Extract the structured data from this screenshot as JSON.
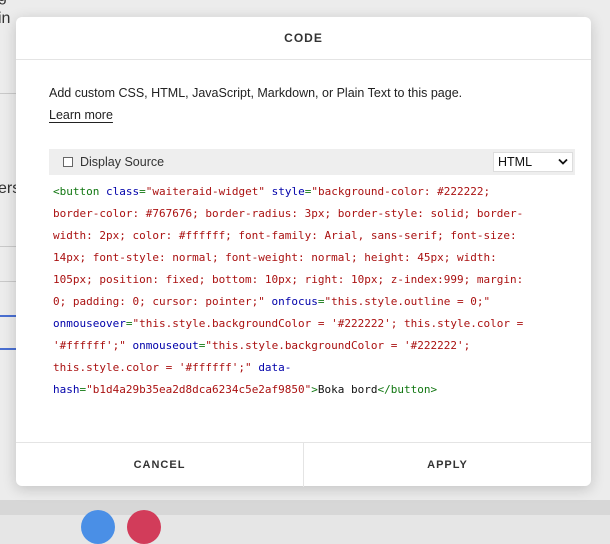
{
  "background": {
    "fragments": [
      "g",
      "in",
      "ers"
    ],
    "dark_text_color": "#333333",
    "accent_blue": "#4a6fd1"
  },
  "modal": {
    "title": "CODE",
    "description": "Add custom CSS, HTML, JavaScript, Markdown, or Plain Text to this page.",
    "learn_more": "Learn more",
    "display_source_label": "Display Source",
    "display_source_checked": false,
    "language_selected": "HTML",
    "chevron_icon": "chevron-down-icon",
    "code_lines": [
      [
        {
          "t": "tag",
          "v": "<button "
        },
        {
          "t": "attr",
          "v": "class"
        },
        {
          "t": "tag",
          "v": "="
        },
        {
          "t": "str",
          "v": "\"waiteraid-widget\""
        },
        {
          "t": "text",
          "v": " "
        },
        {
          "t": "attr",
          "v": "style"
        },
        {
          "t": "tag",
          "v": "="
        },
        {
          "t": "str",
          "v": "\"background-color: #222222;"
        }
      ],
      [
        {
          "t": "str",
          "v": "border-color: #767676; border-radius: 3px; border-style: solid; border-"
        }
      ],
      [
        {
          "t": "str",
          "v": "width: 2px; color: #ffffff; font-family: Arial, sans-serif; font-size:"
        }
      ],
      [
        {
          "t": "str",
          "v": "14px; font-style: normal; font-weight: normal; height: 45px; width:"
        }
      ],
      [
        {
          "t": "str",
          "v": "105px; position: fixed; bottom: 10px; right: 10px; z-index:999; margin:"
        }
      ],
      [
        {
          "t": "str",
          "v": "0; padding: 0; cursor: pointer;\""
        },
        {
          "t": "text",
          "v": " "
        },
        {
          "t": "attr",
          "v": "onfocus"
        },
        {
          "t": "tag",
          "v": "="
        },
        {
          "t": "str",
          "v": "\"this.style.outline = 0;\""
        }
      ],
      [
        {
          "t": "attr",
          "v": "onmouseover"
        },
        {
          "t": "tag",
          "v": "="
        },
        {
          "t": "str",
          "v": "\"this.style.backgroundColor = '#222222'; this.style.color ="
        }
      ],
      [
        {
          "t": "str",
          "v": "'#ffffff';\""
        },
        {
          "t": "text",
          "v": " "
        },
        {
          "t": "attr",
          "v": "onmouseout"
        },
        {
          "t": "tag",
          "v": "="
        },
        {
          "t": "str",
          "v": "\"this.style.backgroundColor = '#222222';"
        }
      ],
      [
        {
          "t": "str",
          "v": "this.style.color = '#ffffff';\""
        },
        {
          "t": "text",
          "v": " "
        },
        {
          "t": "attr",
          "v": "data-"
        }
      ],
      [
        {
          "t": "attr",
          "v": "hash"
        },
        {
          "t": "tag",
          "v": "="
        },
        {
          "t": "str",
          "v": "\"b1d4a29b35ea2d8dca6234c5e2af9850\""
        },
        {
          "t": "tag",
          "v": ">"
        },
        {
          "t": "text",
          "v": "Boka bord"
        },
        {
          "t": "tag",
          "v": "</button>"
        }
      ]
    ],
    "cancel_label": "CANCEL",
    "apply_label": "APPLY"
  },
  "colors": {
    "code_tag": "#117711",
    "code_attr": "#0000aa",
    "code_string": "#aa1111",
    "toolbar_bg": "#eeeeee",
    "circle_blue": "#4a8fe6",
    "circle_red": "#d23c5a"
  }
}
